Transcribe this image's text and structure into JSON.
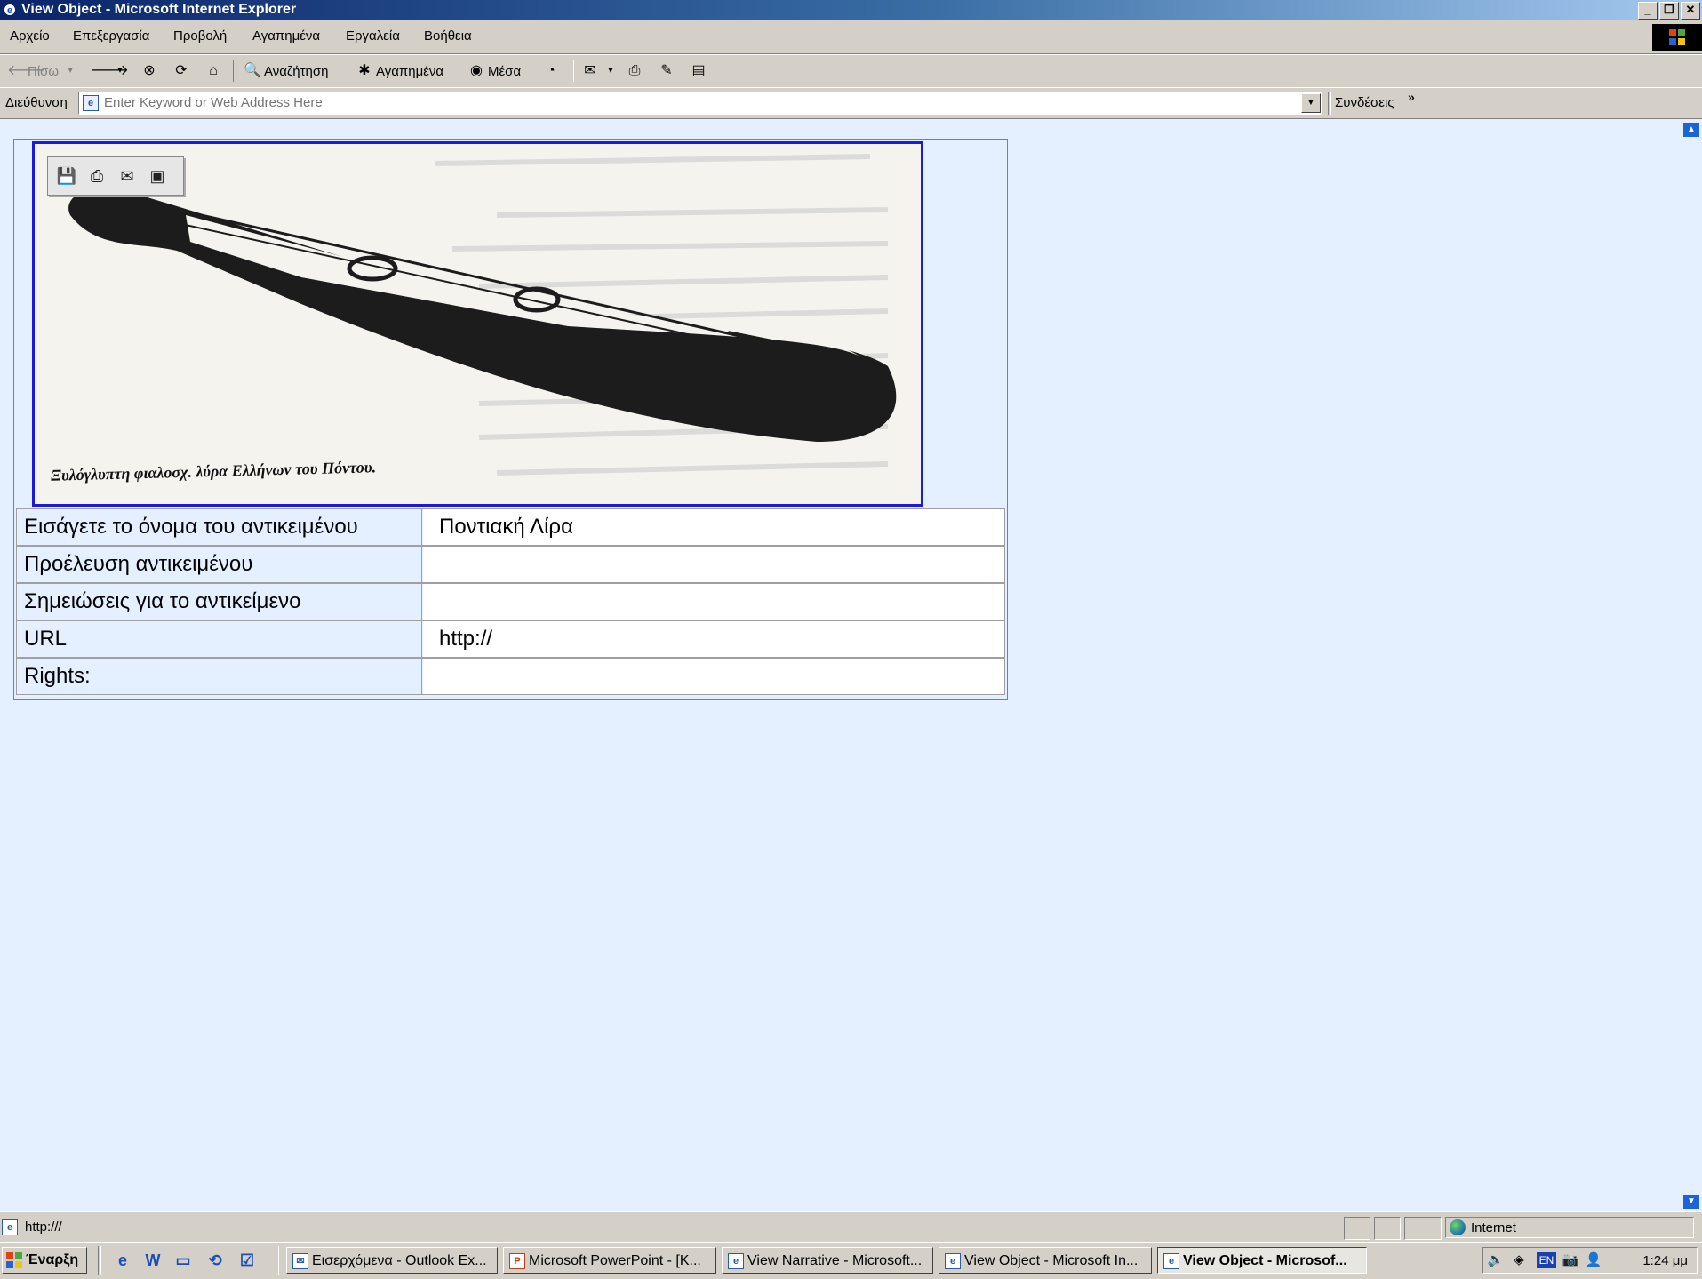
{
  "window": {
    "title": "View Object - Microsoft Internet Explorer",
    "buttons": [
      "_",
      "❐",
      "✕"
    ]
  },
  "menu": [
    "Αρχείο",
    "Επεξεργασία",
    "Προβολή",
    "Αγαπημένα",
    "Εργαλεία",
    "Βοήθεια"
  ],
  "toolbar": {
    "back": "Πίσω",
    "search": "Αναζήτηση",
    "favorites": "Αγαπημένα",
    "media": "Μέσα"
  },
  "address": {
    "label": "Διεύθυνση",
    "placeholder": "Enter Keyword or Web Address Here",
    "links": "Συνδέσεις"
  },
  "object": {
    "image_caption": "Ξυλόγλυπτη φιαλοσχ. λύρα Ελλήνων του Πόντου.",
    "fields": [
      {
        "label": "Εισάγετε το όνομα του αντικειμένου",
        "value": "Ποντιακή Λίρα"
      },
      {
        "label": "Προέλευση αντικειμένου",
        "value": ""
      },
      {
        "label": "Σημειώσεις για το αντικείμενο",
        "value": ""
      },
      {
        "label": "URL",
        "value": "http://"
      },
      {
        "label": "Rights:",
        "value": ""
      }
    ]
  },
  "status": {
    "text": "http:///",
    "zone": "Internet"
  },
  "taskbar": {
    "start": "Έναρξη",
    "tasks": [
      "Εισερχόμενα - Outlook Ex...",
      "Microsoft PowerPoint - [K...",
      "View Narrative - Microsoft...",
      "View Object - Microsoft In...",
      "View Object - Microsof..."
    ],
    "lang": "EN",
    "clock": "1:24 μμ"
  }
}
